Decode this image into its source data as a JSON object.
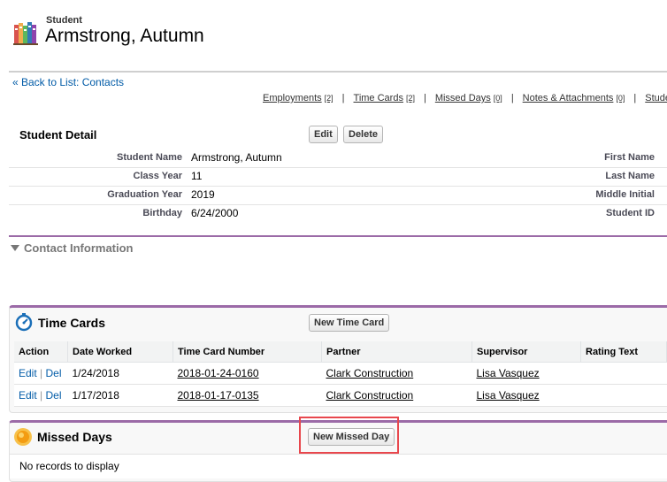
{
  "header": {
    "record_type": "Student",
    "record_name": "Armstrong, Autumn",
    "icon": "books-icon"
  },
  "back_link": "« Back to List: Contacts",
  "related_links": [
    {
      "label": "Employments",
      "count": "[2]"
    },
    {
      "label": "Time Cards",
      "count": "[2]"
    },
    {
      "label": "Missed Days",
      "count": "[0]"
    },
    {
      "label": "Notes & Attachments",
      "count": "[0]"
    },
    {
      "label": "Studen",
      "count": ""
    }
  ],
  "detail": {
    "title": "Student Detail",
    "edit_label": "Edit",
    "delete_label": "Delete",
    "fields": [
      {
        "label": "Student Name",
        "value": "Armstrong, Autumn",
        "right_label": "First Name"
      },
      {
        "label": "Class Year",
        "value": "11",
        "right_label": "Last Name"
      },
      {
        "label": "Graduation Year",
        "value": "2019",
        "right_label": "Middle Initial"
      },
      {
        "label": "Birthday",
        "value": "6/24/2000",
        "right_label": "Student ID"
      }
    ]
  },
  "contact_section": "Contact Information",
  "time_cards": {
    "title": "Time Cards",
    "new_label": "New Time Card",
    "columns": [
      "Action",
      "Date Worked",
      "Time Card Number",
      "Partner",
      "Supervisor",
      "Rating Text"
    ],
    "rows": [
      {
        "edit": "Edit",
        "sep": "|",
        "del": "Del",
        "date": "1/24/2018",
        "number": "2018-01-24-0160",
        "partner": "Clark Construction",
        "supervisor": "Lisa Vasquez",
        "rating": ""
      },
      {
        "edit": "Edit",
        "sep": "|",
        "del": "Del",
        "date": "1/17/2018",
        "number": "2018-01-17-0135",
        "partner": "Clark Construction",
        "supervisor": "Lisa Vasquez",
        "rating": ""
      }
    ]
  },
  "missed_days": {
    "title": "Missed Days",
    "new_label": "New Missed Day",
    "empty_text": "No records to display"
  },
  "colors": {
    "accent": "#9b6aa7",
    "link": "#015ba7",
    "highlight": "#e8474d"
  }
}
